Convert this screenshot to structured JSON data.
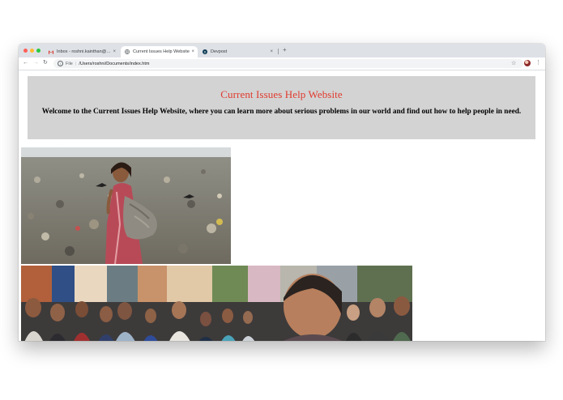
{
  "browser": {
    "tabs": [
      {
        "title": "Inbox - roshni.kainthan@mcvsd.org - Mail",
        "icon": "gmail-icon",
        "active": false
      },
      {
        "title": "Current Issues Help Website",
        "icon": "globe-icon",
        "active": true
      },
      {
        "title": "Devpost",
        "icon": "devpost-icon",
        "active": false
      }
    ],
    "tab_close": "×",
    "new_tab": "+",
    "nav": {
      "back": "←",
      "forward": "→",
      "reload": "↻"
    },
    "address": {
      "scheme": "File",
      "separator": "|",
      "path": "/Users/roshni/Documents/index.htm",
      "info": "i"
    },
    "bookmark": "☆",
    "menu": "⋮"
  },
  "page": {
    "title": "Current Issues Help Website",
    "welcome": "Welcome to the Current Issues Help Website, where you can learn more about serious problems in our world and find out how to help people in need.",
    "title_color": "#e03a2e",
    "header_bg": "#d3d3d3"
  }
}
